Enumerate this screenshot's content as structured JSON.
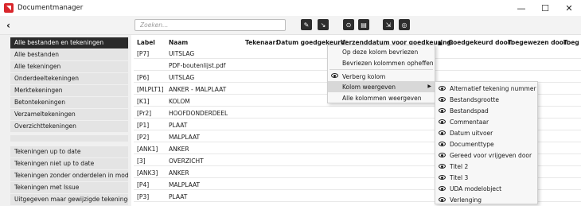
{
  "window": {
    "title": "Documentmanager",
    "controls": {
      "minimize": "—",
      "maximize": "☐",
      "close": "✕"
    }
  },
  "toolbar": {
    "back": "‹",
    "search_placeholder": "Zoeken...",
    "buttons": [
      "✎",
      "↘",
      "⊙",
      "▤",
      "⇲",
      "◎"
    ]
  },
  "sidebar": {
    "group1": [
      "Alle bestanden en tekeningen",
      "Alle bestanden",
      "Alle tekeningen",
      "Onderdeeltekeningen",
      "Merktekeningen",
      "Betontekeningen",
      "Verzameltekeningen",
      "Overzichttekeningen"
    ],
    "group2": [
      "Tekeningen up to date",
      "Tekeningen niet up to date",
      "Tekeningen zonder onderdelen in model",
      "Tekeningen met Issue",
      "Uitgegeven maar gewijzigde tekeningen"
    ]
  },
  "table": {
    "headers": [
      "Label",
      "Naam",
      "Tekenaar:",
      "Datum goedgekeurd:",
      "Verzenddatum voor goedkeuring:",
      "▲",
      "Goedgekeurd door:",
      "Toegewezen door:",
      "Toeg"
    ],
    "rows": [
      [
        "[P7]",
        "UITSLAG"
      ],
      [
        "",
        "PDF-boutenlijst.pdf"
      ],
      [
        "[P6]",
        "UITSLAG"
      ],
      [
        "[MLPLT1]",
        "ANKER - MALPLAAT"
      ],
      [
        "[K1]",
        "KOLOM"
      ],
      [
        "[Pr2]",
        "HOOFDONDERDEEL"
      ],
      [
        "[P1]",
        "PLAAT"
      ],
      [
        "[P2]",
        "MALPLAAT"
      ],
      [
        "[ANK1]",
        "ANKER"
      ],
      [
        "[3]",
        "OVERZICHT"
      ],
      [
        "[ANK3]",
        "ANKER"
      ],
      [
        "[P4]",
        "MALPLAAT"
      ],
      [
        "[P3]",
        "PLAAT"
      ]
    ]
  },
  "context_menu": {
    "freeze_column": "Op deze kolom bevriezen",
    "unfreeze_columns": "Bevriezen kolommen opheffen",
    "hide_column": "Verberg kolom",
    "show_columns": "Kolom weergeven",
    "show_all_columns": "Alle kolommen weergeven",
    "submenu_arrow": "▶"
  },
  "submenu": {
    "items": [
      "Alternatief tekening nummer",
      "Bestandsgrootte",
      "Bestandspad",
      "Commentaar",
      "Datum uitvoer",
      "Documenttype",
      "Gereed voor vrijgeven door",
      "Titel 2",
      "Titel 3",
      "UDA modelobject",
      "Verlenging"
    ]
  },
  "colors": {
    "accent_red": "#d9262b",
    "active_item": "#2b2b2b"
  }
}
